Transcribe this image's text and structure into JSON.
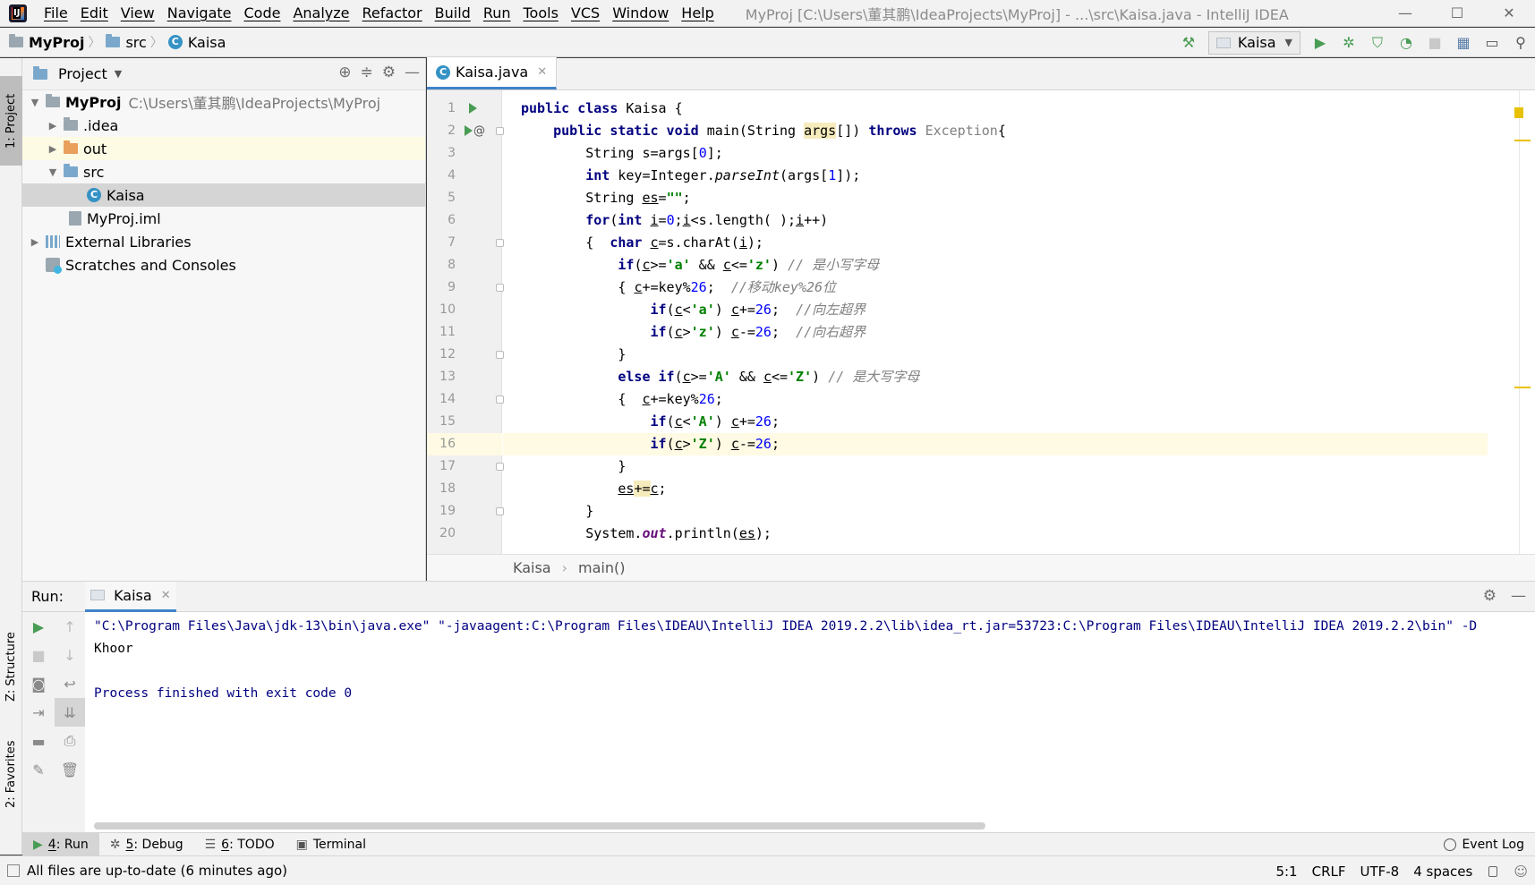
{
  "app": {
    "window_title": "MyProj [C:\\Users\\董其鹏\\IdeaProjects\\MyProj] - ...\\src\\Kaisa.java - IntelliJ IDEA",
    "menu": [
      "File",
      "Edit",
      "View",
      "Navigate",
      "Code",
      "Analyze",
      "Refactor",
      "Build",
      "Run",
      "Tools",
      "VCS",
      "Window",
      "Help"
    ],
    "window_controls": {
      "minimize": "—",
      "maximize": "☐",
      "close": "✕"
    }
  },
  "navbar": {
    "breadcrumbs": [
      "MyProj",
      "src",
      "Kaisa"
    ],
    "run_config": "Kaisa"
  },
  "sidebar_tabs": {
    "project": "1: Project",
    "structure": "Z: Structure",
    "favorites": "2: Favorites"
  },
  "project_panel": {
    "title": "Project",
    "tree": [
      {
        "label": "MyProj",
        "hint": "C:\\Users\\董其鹏\\IdeaProjects\\MyProj",
        "icon": "module-folder-icon",
        "expanded": true
      },
      {
        "label": ".idea",
        "icon": "folder-icon",
        "expanded": false
      },
      {
        "label": "out",
        "icon": "excluded-folder-icon",
        "expanded": false
      },
      {
        "label": "src",
        "icon": "source-folder-icon",
        "expanded": true
      },
      {
        "label": "Kaisa",
        "icon": "java-class-icon",
        "selected": true
      },
      {
        "label": "MyProj.iml",
        "icon": "iml-file-icon"
      },
      {
        "label": "External Libraries",
        "icon": "library-icon",
        "expanded": false
      },
      {
        "label": "Scratches and Consoles",
        "icon": "scratches-icon"
      }
    ]
  },
  "editor": {
    "tab_label": "Kaisa.java",
    "line_numbers": [
      "1",
      "2",
      "3",
      "4",
      "5",
      "6",
      "7",
      "8",
      "9",
      "10",
      "11",
      "12",
      "13",
      "14",
      "15",
      "16",
      "17",
      "18",
      "19",
      "20"
    ],
    "current_line": 16,
    "breadcrumb": [
      "Kaisa",
      "main()"
    ]
  },
  "run_panel": {
    "label": "Run:",
    "tab": "Kaisa",
    "console": [
      "\"C:\\Program Files\\Java\\jdk-13\\bin\\java.exe\" \"-javaagent:C:\\Program Files\\IDEAU\\IntelliJ IDEA 2019.2.2\\lib\\idea_rt.jar=53723:C:\\Program Files\\IDEAU\\IntelliJ IDEA 2019.2.2\\bin\" -D",
      "Khoor",
      "",
      "Process finished with exit code 0"
    ]
  },
  "bottom_tabs": [
    {
      "key": "4",
      "label": ": Run"
    },
    {
      "key": "5",
      "label": ": Debug"
    },
    {
      "key": "6",
      "label": ": TODO"
    },
    {
      "key": "",
      "label": "Terminal"
    }
  ],
  "event_log": "Event Log",
  "status": {
    "message": "All files are up-to-date (6 minutes ago)",
    "position": "5:1",
    "line_sep": "CRLF",
    "encoding": "UTF-8",
    "indent": "4 spaces"
  },
  "colors": {
    "keyword": "#000080",
    "string": "#008000",
    "number": "#0000ff",
    "comment": "#808080",
    "run": "#499c54"
  }
}
